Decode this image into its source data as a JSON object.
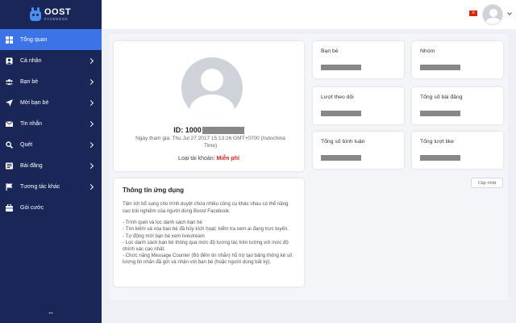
{
  "brand": {
    "name": "OOST",
    "subtitle": "FACEBOOK",
    "color": "#1a2657",
    "accent": "#3c74e8"
  },
  "sidebar": {
    "items": [
      {
        "label": "Tổng quan",
        "icon": "dashboard-icon",
        "active": true,
        "has_chevron": false
      },
      {
        "label": "Cá nhân",
        "icon": "person-icon",
        "active": false,
        "has_chevron": true
      },
      {
        "label": "Bạn bè",
        "icon": "friends-icon",
        "active": false,
        "has_chevron": true
      },
      {
        "label": "Mời bạn bè",
        "icon": "send-icon",
        "active": false,
        "has_chevron": true
      },
      {
        "label": "Tin nhắn",
        "icon": "envelope-icon",
        "active": false,
        "has_chevron": true
      },
      {
        "label": "Quét",
        "icon": "search-icon",
        "active": false,
        "has_chevron": true
      },
      {
        "label": "Bài đăng",
        "icon": "post-icon",
        "active": false,
        "has_chevron": true
      },
      {
        "label": "Tương tác khác",
        "icon": "flag-icon",
        "active": false,
        "has_chevron": true
      },
      {
        "label": "Gói cước",
        "icon": "package-icon",
        "active": false,
        "has_chevron": false
      }
    ],
    "toggle_glyph": "↔"
  },
  "profile": {
    "id_prefix": "ID: 1000",
    "joined": "Ngày tham gia: Thu Jul 27 2017 15:13:26 GMT+0700 (Indochina Time)",
    "account_type_label": "Loại tài khoản:",
    "account_type_value": "Miễn phí"
  },
  "info": {
    "title": "Thông tin ứng dụng",
    "description": "Tiện ích bổ sung cho trình duyệt chứa nhiều công cụ khác nhau có thể nâng cao trải nghiệm của người dùng Boost Facebook.",
    "features": [
      "- Trình quét và lọc danh sách bạn bè",
      "- Tìm kiếm và xóa bạn bè đã hủy kích hoạt; kiểm tra xem ai đang trực tuyến.",
      "- Tự động mời bạn bè xem livestream",
      "- Lọc danh sách bạn bè thông qua mức độ tương tác trên tường với mức độ chính xác cao nhất.",
      "- Chức năng Message Counter (Bộ đếm tin nhắn) hỗ trợ tạo bảng thống kê số lượng tin nhắn đã gửi và nhận với bạn bè (hoặc người dùng bất kỳ)."
    ]
  },
  "stats": [
    {
      "label": "Bạn bè"
    },
    {
      "label": "Nhóm"
    },
    {
      "label": "Lượt theo dõi"
    },
    {
      "label": "Tổng số bài đăng"
    },
    {
      "label": "Tổng số bình luận"
    },
    {
      "label": "Tổng lượt like"
    }
  ],
  "update_button": "Cập nhật"
}
